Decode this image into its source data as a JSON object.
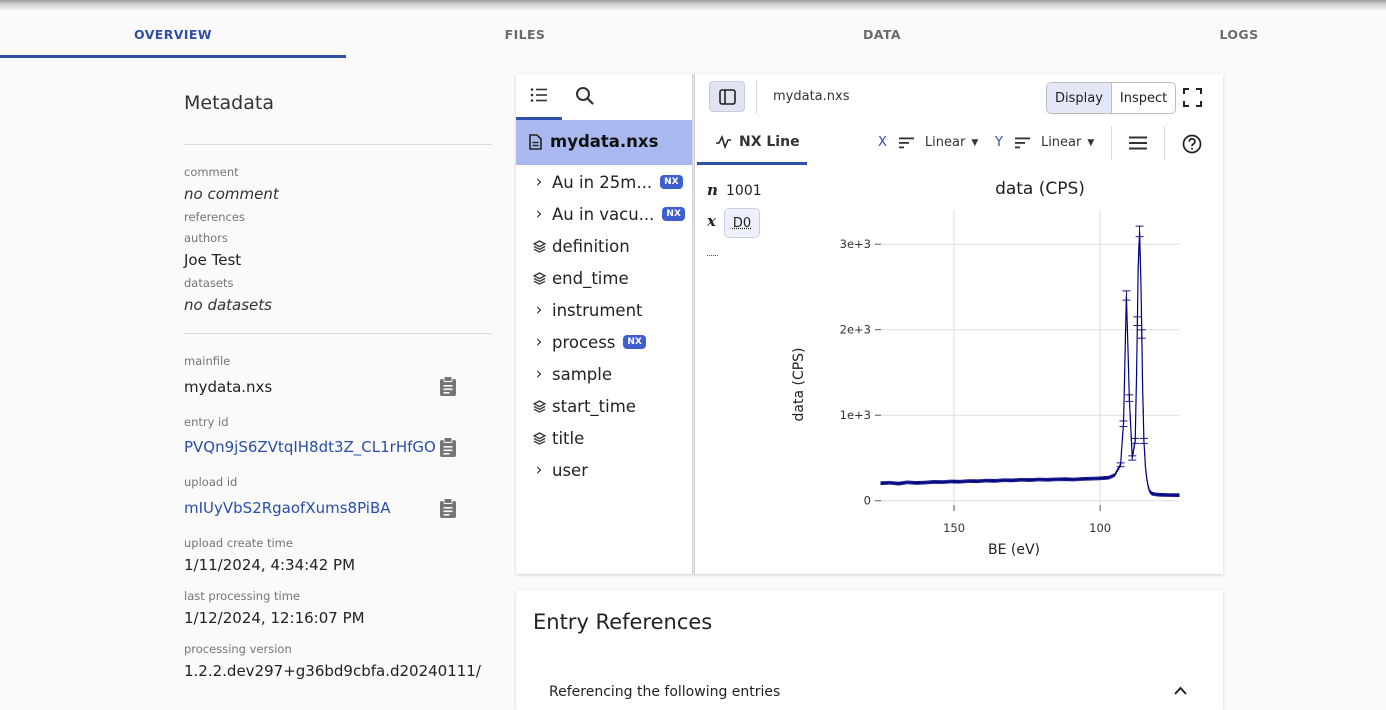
{
  "tabs": [
    {
      "label": "OVERVIEW"
    },
    {
      "label": "FILES"
    },
    {
      "label": "DATA"
    },
    {
      "label": "LOGS"
    }
  ],
  "metadata": {
    "title": "Metadata",
    "comment_label": "comment",
    "comment_value": "no comment",
    "references_label": "references",
    "authors_label": "authors",
    "authors_value": "Joe Test",
    "datasets_label": "datasets",
    "datasets_value": "no datasets",
    "mainfile_label": "mainfile",
    "mainfile_value": "mydata.nxs",
    "entry_id_label": "entry id",
    "entry_id_value": "PVQn9jS6ZVtqIH8dt3Z_CL1rHfGO",
    "upload_id_label": "upload id",
    "upload_id_value": "mIUyVbS2RgaofXums8PiBA",
    "upload_create_label": "upload create time",
    "upload_create_value": "1/11/2024, 4:34:42 PM",
    "last_processing_label": "last processing time",
    "last_processing_value": "1/12/2024, 12:16:07 PM",
    "processing_version_label": "processing version",
    "processing_version_value": "1.2.2.dev297+g36bd9cbfa.d20240111/"
  },
  "tree": {
    "root": "mydata.nxs",
    "items": [
      {
        "label": "Au in 25m...",
        "badge": "NX",
        "kind": "group"
      },
      {
        "label": "Au in vacu...",
        "badge": "NX",
        "kind": "group"
      },
      {
        "label": "definition",
        "badge": "",
        "kind": "dataset"
      },
      {
        "label": "end_time",
        "badge": "",
        "kind": "dataset"
      },
      {
        "label": "instrument",
        "badge": "",
        "kind": "group"
      },
      {
        "label": "process",
        "badge": "NX",
        "kind": "group"
      },
      {
        "label": "sample",
        "badge": "",
        "kind": "group"
      },
      {
        "label": "start_time",
        "badge": "",
        "kind": "dataset"
      },
      {
        "label": "title",
        "badge": "",
        "kind": "dataset"
      },
      {
        "label": "user",
        "badge": "",
        "kind": "group"
      }
    ]
  },
  "viewer": {
    "filename": "mydata.nxs",
    "display_label": "Display",
    "inspect_label": "Inspect",
    "nx_line_label": "NX Line",
    "x_label": "X",
    "x_scale": "Linear",
    "y_label": "Y",
    "y_scale": "Linear",
    "n_symbol": "n",
    "n_value": "1001",
    "x_symbol": "x",
    "x_value": "D0"
  },
  "chart_data": {
    "type": "line",
    "title": "data (CPS)",
    "xlabel": "BE (eV)",
    "ylabel": "data (CPS)",
    "x_axis_reversed": true,
    "xlim": [
      175,
      73
    ],
    "ylim": [
      -50,
      3400
    ],
    "x_ticks": [
      {
        "value": 150,
        "label": "150"
      },
      {
        "value": 100,
        "label": "100"
      }
    ],
    "y_ticks": [
      {
        "value": 0,
        "label": "0"
      },
      {
        "value": 1000,
        "label": "1e+3"
      },
      {
        "value": 2000,
        "label": "2e+3"
      },
      {
        "value": 3000,
        "label": "3e+3"
      }
    ],
    "grid": true,
    "error_bars": true,
    "color": "#000080",
    "series": [
      {
        "x": [
          175,
          172,
          169,
          166,
          163,
          160,
          157,
          154,
          151,
          148,
          145,
          142,
          139,
          136,
          133,
          130,
          127,
          124,
          121,
          118,
          115,
          112,
          109,
          106,
          103,
          100,
          97,
          95,
          93,
          92,
          91,
          90,
          89,
          88,
          87.5,
          87,
          86.5,
          86,
          85.5,
          85,
          84.5,
          84,
          83.5,
          83,
          82.5,
          82,
          81,
          80,
          78,
          76,
          74,
          73
        ],
        "y": [
          205,
          210,
          200,
          215,
          208,
          212,
          220,
          218,
          225,
          222,
          230,
          228,
          235,
          232,
          240,
          238,
          245,
          242,
          248,
          245,
          250,
          252,
          248,
          255,
          258,
          262,
          270,
          300,
          420,
          900,
          2400,
          1200,
          500,
          700,
          1500,
          2700,
          3150,
          2500,
          1400,
          700,
          400,
          250,
          160,
          110,
          90,
          80,
          75,
          70,
          68,
          66,
          65,
          65
        ]
      }
    ]
  },
  "references": {
    "title": "Entry References",
    "row_label": "Referencing the following entries"
  },
  "colors": {
    "accent": "#2f4fa8",
    "tree_selected": "#aab8f0",
    "badge": "#3f5fd1",
    "line": "#000080"
  }
}
